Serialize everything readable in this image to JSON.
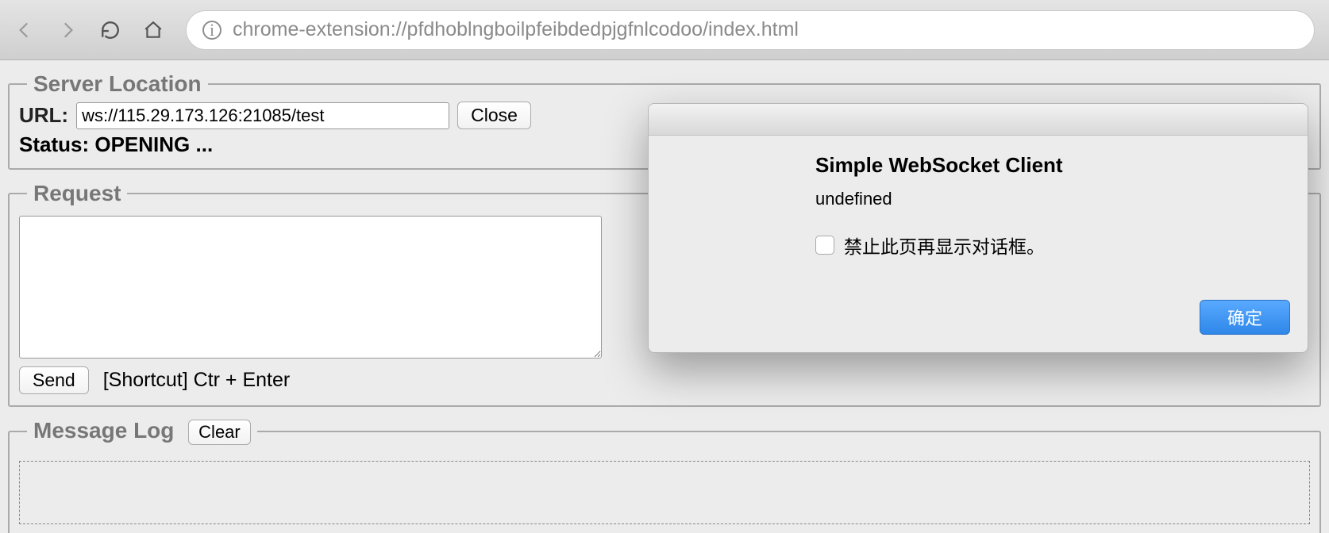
{
  "toolbar": {
    "url": "chrome-extension://pfdhoblngboilpfeibdedpjgfnlcodoo/index.html"
  },
  "server_location": {
    "legend": "Server Location",
    "url_label": "URL:",
    "url_value": "ws://115.29.173.126:21085/test",
    "close_label": "Close",
    "status_label": "Status:",
    "status_value": "OPENING ..."
  },
  "request": {
    "legend": "Request",
    "body": "",
    "send_label": "Send",
    "shortcut_hint": "[Shortcut] Ctr + Enter"
  },
  "message_log": {
    "legend": "Message Log",
    "clear_label": "Clear"
  },
  "dialog": {
    "title": "Simple WebSocket Client",
    "message": "undefined",
    "suppress_label": "禁止此页再显示对话框。",
    "ok_label": "确定"
  }
}
